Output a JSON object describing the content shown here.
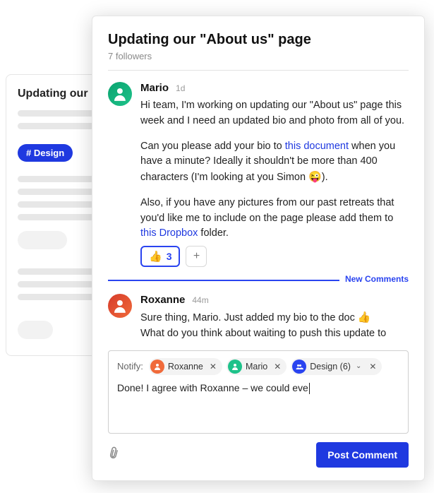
{
  "background": {
    "title": "Updating our \"A",
    "tag": "# Design"
  },
  "thread": {
    "title": "Updating our \"About us\" page",
    "followers": "7 followers",
    "new_divider": "New Comments"
  },
  "comments": [
    {
      "author": "Mario",
      "time": "1d",
      "p1a": "Hi team, I'm working on updating our \"About us\" page this week and I need an updated bio and photo from all of you.",
      "p2a": "Can you please add your bio to ",
      "p2link": "this document",
      "p2b": " when you have a minute? Ideally it shouldn't be more than 400 characters (I'm looking at you Simon ",
      "p2emoji": "😜",
      "p2c": ").",
      "p3a": "Also, if you have any pictures from our past retreats that you'd like me to include on the page please add them to ",
      "p3link": "this Dropbox",
      "p3b": " folder.",
      "reaction_emoji": "👍",
      "reaction_count": "3"
    },
    {
      "author": "Roxanne",
      "time": "44m",
      "line1a": "Sure thing, Mario. Just added my bio to the doc ",
      "line1emoji": "👍",
      "line2": "What do you think about waiting to push this update to"
    }
  ],
  "compose": {
    "notify_label": "Notify:",
    "chips": {
      "roxanne": "Roxanne",
      "mario": "Mario",
      "design": "Design (6)"
    },
    "text": "Done! I agree with Roxanne – we could eve",
    "post_label": "Post Comment"
  }
}
